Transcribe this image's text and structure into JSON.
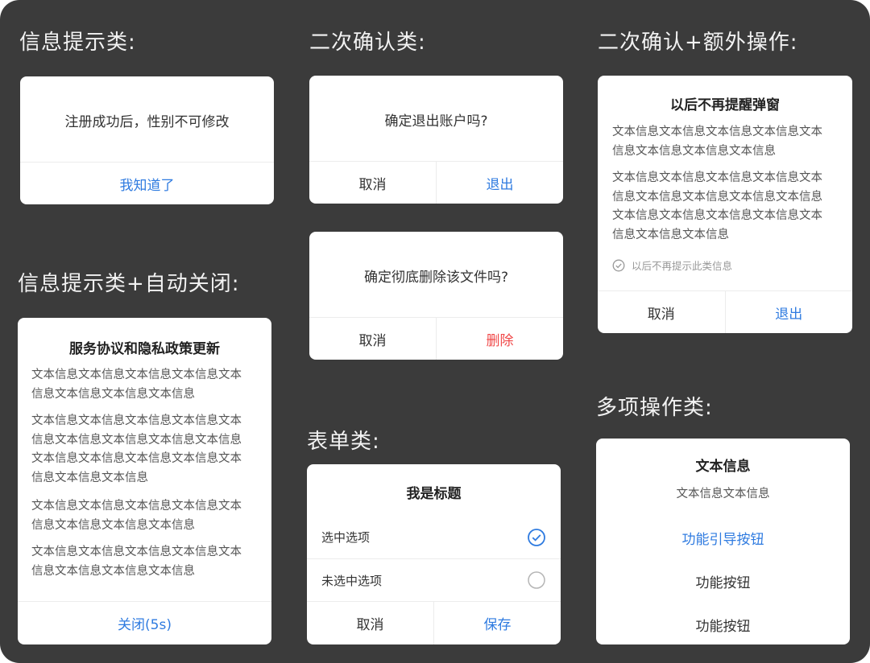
{
  "headings": {
    "info": "信息提示类:",
    "confirm": "二次确认类:",
    "confirm_extra": "二次确认+额外操作:",
    "info_auto": "信息提示类+自动关闭:",
    "form": "表单类:",
    "multi": "多项操作类:"
  },
  "info_card": {
    "message": "注册成功后，性别不可修改",
    "button": "我知道了"
  },
  "logout_card": {
    "message": "确定退出账户吗?",
    "cancel": "取消",
    "confirm": "退出"
  },
  "delete_card": {
    "message": "确定彻底删除该文件吗?",
    "cancel": "取消",
    "confirm": "删除"
  },
  "extra_card": {
    "title": "以后不再提醒弹窗",
    "para1": [
      "文本信息文本信息文本信息文本信息文本",
      "信息文本信息文本信息文本信息"
    ],
    "para2": [
      "文本信息文本信息文本信息文本信息文本",
      "信息文本信息文本信息文本信息文本信息",
      "文本信息文本信息文本信息文本信息文本",
      "信息文本信息文本信息"
    ],
    "checkbox_label": "以后不再提示此类信息",
    "cancel": "取消",
    "confirm": "退出"
  },
  "auto_card": {
    "title": "服务协议和隐私政策更新",
    "para1": [
      "文本信息文本信息文本信息文本信息文本",
      "信息文本信息文本信息文本信息"
    ],
    "para2": [
      "文本信息文本信息文本信息文本信息文本",
      "信息文本信息文本信息文本信息文本信息",
      "文本信息文本信息文本信息文本信息文本",
      "信息文本信息文本信息"
    ],
    "para3": [
      "文本信息文本信息文本信息文本信息文本",
      "信息文本信息文本信息文本信息"
    ],
    "para4": [
      "文本信息文本信息文本信息文本信息文本",
      "信息文本信息文本信息文本信息"
    ],
    "button": "关闭(5s)"
  },
  "form_card": {
    "title": "我是标题",
    "option_selected": "选中选项",
    "option_unselected": "未选中选项",
    "cancel": "取消",
    "save": "保存"
  },
  "multi_card": {
    "title": "文本信息",
    "subtitle": "文本信息文本信息",
    "guide_button": "功能引导按钮",
    "button1": "功能按钮",
    "button2": "功能按钮"
  },
  "colors": {
    "background": "#3b3b3b",
    "accent": "#2f7be0",
    "danger": "#f04848",
    "card": "#ffffff"
  }
}
